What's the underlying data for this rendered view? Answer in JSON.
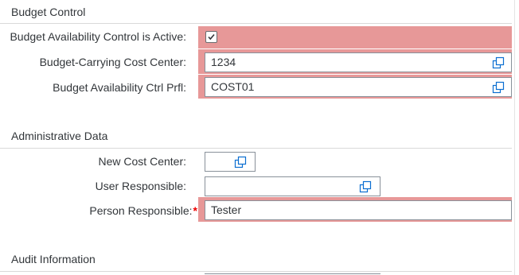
{
  "sections": {
    "budget_control": {
      "title": "Budget Control"
    },
    "administrative_data": {
      "title": "Administrative Data"
    },
    "audit_information": {
      "title": "Audit Information"
    }
  },
  "fields": {
    "budget_availability_control_active": {
      "label": "Budget Availability Control is Active:",
      "checked": true
    },
    "budget_carrying_cost_center": {
      "label": "Budget-Carrying Cost Center:",
      "value": "1234"
    },
    "budget_availability_ctrl_prfl": {
      "label": "Budget Availability Ctrl Prfl:",
      "value": "COST01"
    },
    "new_cost_center": {
      "label": "New Cost Center:",
      "value": ""
    },
    "user_responsible": {
      "label": "User Responsible:",
      "value": ""
    },
    "person_responsible": {
      "label": "Person Responsible:",
      "required_marker": "*",
      "value": "Tester"
    }
  },
  "icons": {
    "value_help": "value-help-icon",
    "checkmark": "check-icon"
  },
  "colors": {
    "highlight": "#e79898",
    "required": "#ee0000",
    "field_border": "#89919a",
    "text": "#32363a"
  }
}
